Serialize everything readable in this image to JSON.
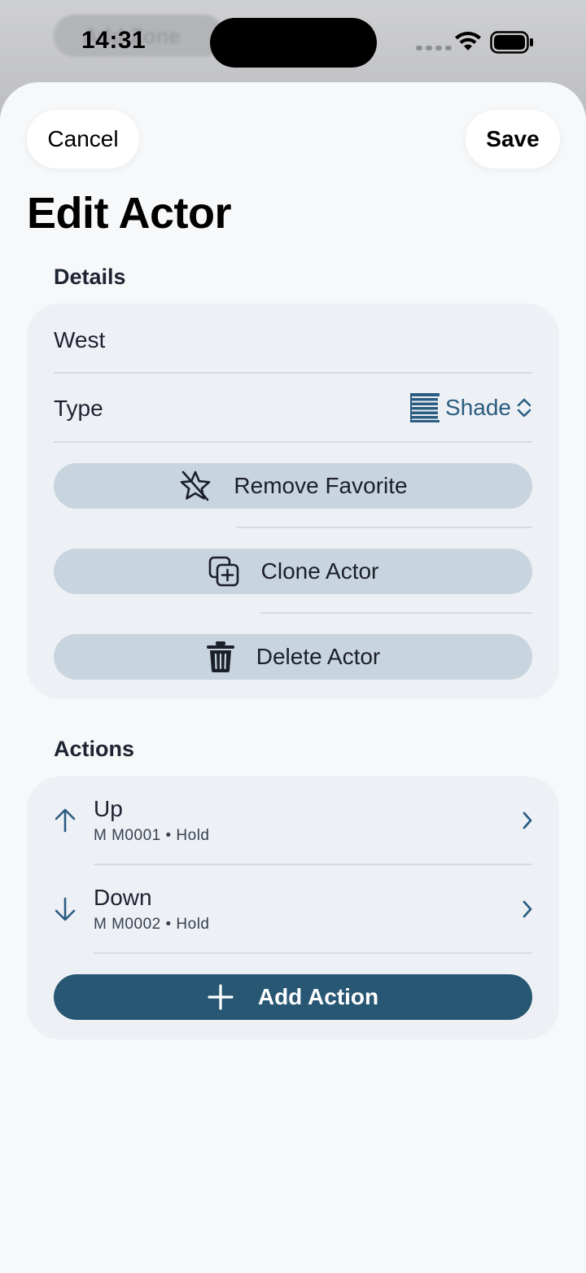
{
  "status_bar": {
    "time": "14:31"
  },
  "background": {
    "peek_label": "Add Zone"
  },
  "nav": {
    "cancel_label": "Cancel",
    "save_label": "Save",
    "title": "Edit Actor"
  },
  "details": {
    "header": "Details",
    "name_value": "West",
    "type_label": "Type",
    "type_value": "Shade",
    "type_icon": "shade-blinds-icon",
    "remove_favorite_label": "Remove Favorite",
    "clone_label": "Clone Actor",
    "delete_label": "Delete Actor"
  },
  "actions": {
    "header": "Actions",
    "items": [
      {
        "title": "Up",
        "subtitle": "M M0001 • Hold",
        "icon": "arrow-up-icon"
      },
      {
        "title": "Down",
        "subtitle": "M M0002 • Hold",
        "icon": "arrow-down-icon"
      }
    ],
    "add_label": "Add Action"
  },
  "colors": {
    "accent": "#285773",
    "tint": "#2b5d82",
    "button_fill": "#c8d4de",
    "card": "#edf1f5"
  }
}
